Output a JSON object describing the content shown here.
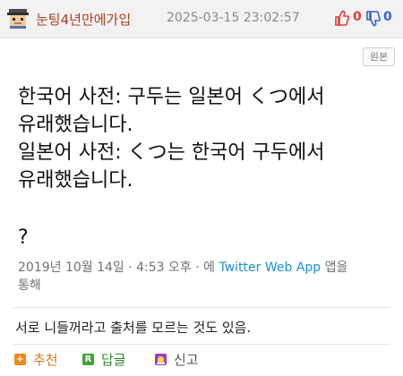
{
  "post": {
    "nickname": "눈팅4년만에가입",
    "timestamp": "2025-03-15 23:02:57",
    "upvotes": "0",
    "downvotes": "0",
    "original_label": "원본"
  },
  "tweet": {
    "lines": [
      "한국어 사전: 구두는 일본어 くつ에서",
      "유래했습니다.",
      "일본어 사전: くつ는 한국어 구두에서",
      "유래했습니다."
    ],
    "trailing": "?",
    "date": "2019년 10월 14일 · 4:53 오후 · 에 ",
    "app": "Twitter Web App",
    "via_1": " 앱을",
    "via_2": "통해"
  },
  "comment": {
    "text": "서로 니들꺼라고 출처를 모르는 것도 있음."
  },
  "actions": {
    "recommend_icon": "+",
    "recommend": "추천",
    "reply_icon": "R",
    "reply": "답글",
    "report": "신고"
  },
  "colors": {
    "nickname": "#b23b1e",
    "upvote": "#e23a3a",
    "downvote": "#2f63d6",
    "link": "#1d8fd6"
  }
}
